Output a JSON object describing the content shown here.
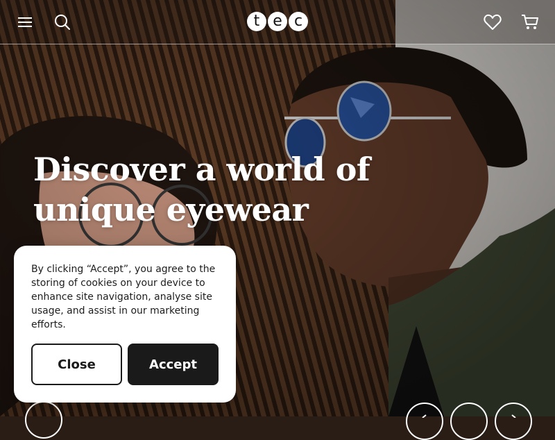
{
  "header": {
    "logo_letters": [
      "t",
      "e",
      "c"
    ],
    "icons": [
      "menu-icon",
      "search-icon",
      "heart-icon",
      "cart-icon"
    ]
  },
  "hero": {
    "headline": "Discover a world of unique eyewear"
  },
  "cookie_banner": {
    "text": "By clicking “Accept”, you agree to the storing of cookies on your device to enhance site navigation, analyse site usage, and assist in our marketing efforts.",
    "close_label": "Close",
    "accept_label": "Accept"
  },
  "colors": {
    "accent_dark": "#1a1a1a",
    "white": "#ffffff"
  }
}
